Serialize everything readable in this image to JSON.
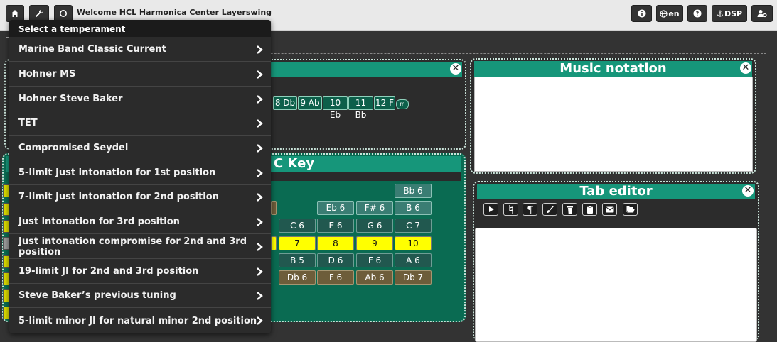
{
  "topbar": {
    "welcome": "Welcome HCL Harmonica Center Layerswing",
    "lang_label": "en",
    "dsp_label": "DSP"
  },
  "panels": {
    "music_notation": {
      "title": "Music notation"
    },
    "tab_editor": {
      "title": "Tab editor"
    },
    "key_panel": {
      "title_visible": "C Key"
    }
  },
  "notes_row": [
    "8 Db",
    "9 Ab",
    "10 Eb",
    "11 Bb",
    "12 F"
  ],
  "notes_mini": "m",
  "grid": {
    "r0": [
      "Bb 6"
    ],
    "r1": [
      "Eb 6",
      "F# 6",
      "B 6"
    ],
    "r2": [
      "C 6",
      "E 6",
      "G 6",
      "C 7"
    ],
    "r3": [
      "7",
      "8",
      "9",
      "10"
    ],
    "r4": [
      "B 5",
      "D 6",
      "F 6",
      "A 6"
    ],
    "r5": [
      "Db 6",
      "F 6",
      "Ab 6",
      "Db 7"
    ]
  },
  "menu": {
    "header": "Select a temperament",
    "items": [
      "Marine Band Classic Current",
      "Hohner MS",
      "Hohner Steve Baker",
      "TET",
      "Compromised Seydel",
      "5-limit Just intonation for 1st position",
      "7-limit Just intonation for 2nd position",
      "Just intonation for 3rd position",
      "Just intonation compromise for 2nd and 3rd position",
      "19-limit JI for 2nd and 3rd position",
      "Steve Baker’s previous tuning",
      "5-limit minor JI for natural minor 2nd position"
    ]
  },
  "colors": {
    "accent": "#16967a",
    "panel_green": "#0a6b52",
    "highlight": "#ffff00",
    "menu_bg": "#2b2b2b"
  }
}
